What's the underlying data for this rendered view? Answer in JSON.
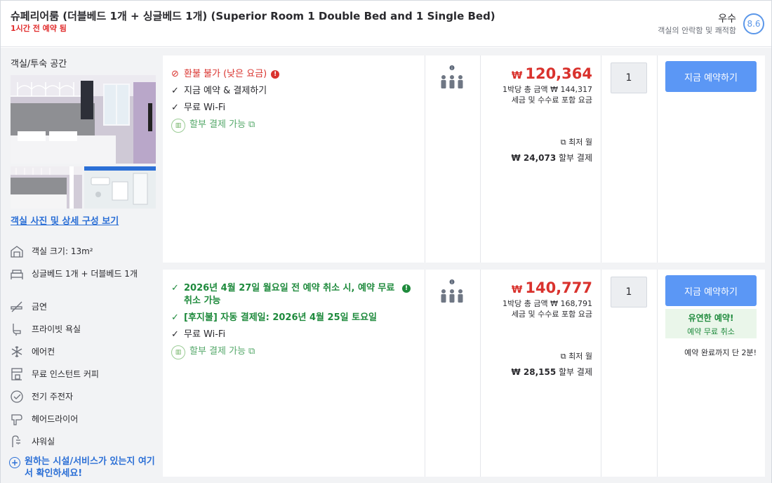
{
  "header": {
    "room_title": "슈페리어룸 (더블베드 1개 + 싱글베드 1개) (Superior Room 1 Double Bed and 1 Single Bed)",
    "booked_note": "1시간 전 예약 됨",
    "rating_word": "우수",
    "rating_sub": "객실의 안락함 및 쾌적함",
    "score": "8.6"
  },
  "left": {
    "section_label": "객실/투숙 공간",
    "photo_link": "객실 사진 및 상세 구성 보기",
    "amenities": [
      {
        "icon": "room-size-icon",
        "label": "객실 크기: 13m²"
      },
      {
        "icon": "bed-icon",
        "label": "싱글베드 1개 + 더블베드 1개"
      },
      {
        "icon": "no-smoking-icon",
        "label": "금연"
      },
      {
        "icon": "private-bath-icon",
        "label": "프라이빗 욕실"
      },
      {
        "icon": "snowflake-icon",
        "label": "에어컨"
      },
      {
        "icon": "coffee-maker-icon",
        "label": "무료 인스턴트 커피"
      },
      {
        "icon": "kettle-icon",
        "label": "전기 주전자"
      },
      {
        "icon": "hair-dryer-icon",
        "label": "헤어드라이어"
      },
      {
        "icon": "shower-icon",
        "label": "샤워실"
      }
    ],
    "cta": "원하는 시설/서비스가 있는지 여기서 확인하세요!"
  },
  "offers": [
    {
      "features": [
        {
          "type": "red",
          "mark": "⊘",
          "label": "환불 불가 (낮은 요금)",
          "info": true
        },
        {
          "type": "normal",
          "mark": "✓",
          "label": "지금 예약 & 결제하기"
        },
        {
          "type": "normal",
          "mark": "✓",
          "label": "무료 Wi-Fi"
        }
      ],
      "installment": "할부 결제 가능",
      "currency": "₩",
      "price": "120,364",
      "total_line": "1박당 총 금액 ₩ 144,317",
      "tax_line": "세금 및 수수료 포함 요금",
      "lowest": "최저 월",
      "inst_amount": "₩ 24,073",
      "inst_label": "할부 결제",
      "qty": "1",
      "book_label": "지금 예약하기"
    },
    {
      "features": [
        {
          "type": "green",
          "mark": "✓",
          "label": "2026년 4월 27일 월요일 전 예약 취소 시, 예약 무료 취소 가능",
          "info": true
        },
        {
          "type": "green",
          "mark": "✓",
          "label": "[후지불] 자동 결제일: 2026년 4월 25일 토요일"
        },
        {
          "type": "normal",
          "mark": "✓",
          "label": "무료 Wi-Fi"
        }
      ],
      "installment": "할부 결제 가능",
      "currency": "₩",
      "price": "140,777",
      "total_line": "1박당 총 금액 ₩ 168,791",
      "tax_line": "세금 및 수수료 포함 요금",
      "lowest": "최저 월",
      "inst_amount": "₩ 28,155",
      "inst_label": "할부 결제",
      "qty": "1",
      "book_label": "지금 예약하기",
      "flex_title": "유연한 예약!",
      "flex_sub": "예약 무료 취소",
      "hurry": "예약 완료까지 단 2분!"
    }
  ],
  "colors": {
    "accent_blue": "#5b97f5",
    "price_red": "#d9322d",
    "free_cancel_green": "#1e8a3c"
  }
}
